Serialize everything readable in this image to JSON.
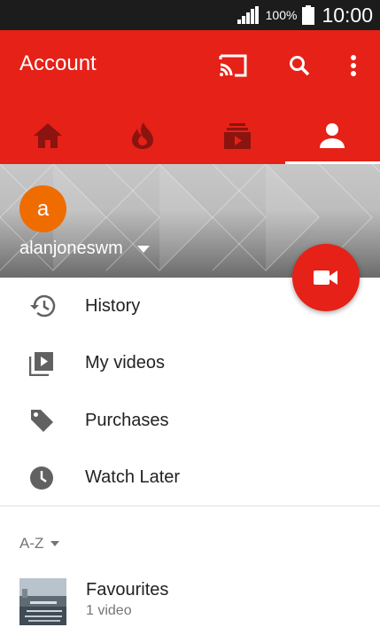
{
  "status_bar": {
    "battery_pct": "100%",
    "time": "10:00"
  },
  "app_bar": {
    "title": "Account",
    "icons": [
      "cast-icon",
      "search-icon",
      "more-vert-icon"
    ]
  },
  "tabs": [
    {
      "name": "home-icon",
      "active": false
    },
    {
      "name": "trending-icon",
      "active": false
    },
    {
      "name": "subscriptions-icon",
      "active": false
    },
    {
      "name": "account-icon",
      "active": true
    }
  ],
  "profile": {
    "avatar_letter": "a",
    "username": "alanjoneswm"
  },
  "menu": [
    {
      "label": "History",
      "icon": "history-icon"
    },
    {
      "label": "My videos",
      "icon": "my-videos-icon"
    },
    {
      "label": "Purchases",
      "icon": "tag-icon"
    },
    {
      "label": "Watch Later",
      "icon": "clock-icon"
    }
  ],
  "sort": {
    "label": "A-Z"
  },
  "playlists": [
    {
      "title": "Favourites",
      "subtitle": "1 video"
    }
  ],
  "colors": {
    "brand_red": "#e62117",
    "avatar_orange": "#ef6c00"
  }
}
